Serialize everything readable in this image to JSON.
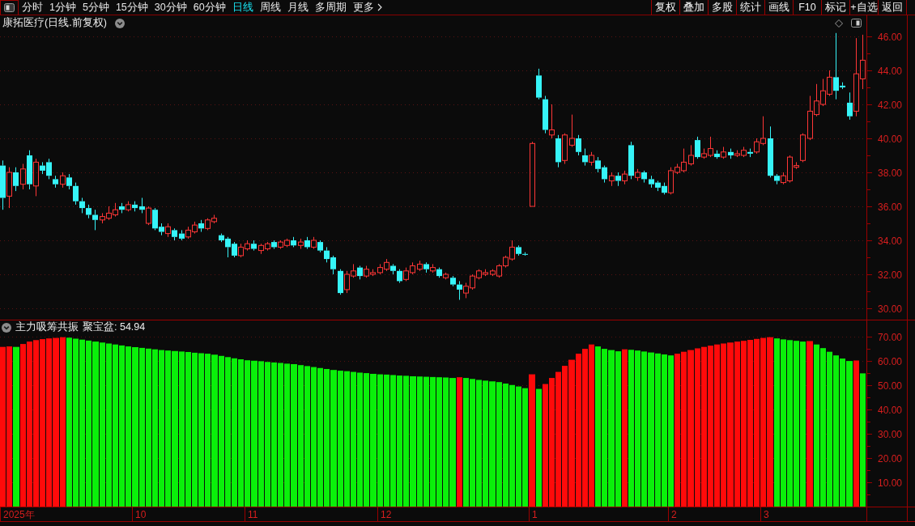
{
  "toolbar": {
    "tabs": [
      {
        "label": "分时",
        "kind": "tab",
        "selected": false
      },
      {
        "label": "1分钟",
        "kind": "tab",
        "selected": false
      },
      {
        "label": "5分钟",
        "kind": "tab",
        "selected": false
      },
      {
        "label": "15分钟",
        "kind": "tab",
        "selected": false
      },
      {
        "label": "30分钟",
        "kind": "tab",
        "selected": false
      },
      {
        "label": "60分钟",
        "kind": "tab",
        "selected": false
      },
      {
        "label": "日线",
        "kind": "tab",
        "selected": true
      },
      {
        "label": "周线",
        "kind": "tab",
        "selected": false
      },
      {
        "label": "月线",
        "kind": "tab",
        "selected": false
      },
      {
        "label": "多周期",
        "kind": "tab",
        "selected": false
      },
      {
        "label": "更多",
        "kind": "menu",
        "selected": false
      }
    ],
    "buttons": [
      "复权",
      "叠加",
      "多股",
      "统计",
      "画线",
      "F10",
      "标记",
      "+自选",
      "返回"
    ]
  },
  "price_panel": {
    "title": "康拓医疗(日线.前复权)",
    "y_axis_labels": [
      "46.00",
      "44.00",
      "42.00",
      "40.00",
      "38.00",
      "36.00",
      "34.00",
      "32.00",
      "30.00"
    ]
  },
  "indicator_panel": {
    "name": "主力吸筹共振",
    "reading": "聚宝盆: 54.94",
    "chart_data": {
      "type": "bar",
      "grid": true,
      "ylim": [
        0,
        76.7
      ],
      "yticks": [
        {
          "value": 70,
          "label": "70.00"
        },
        {
          "value": 60,
          "label": "60.00"
        },
        {
          "value": 50,
          "label": "50.00"
        },
        {
          "value": 40,
          "label": "40.00"
        },
        {
          "value": 30,
          "label": "30.00"
        },
        {
          "value": 20,
          "label": "20.00"
        },
        {
          "value": 10,
          "label": "10.00"
        }
      ],
      "values": [
        65.8,
        66.0,
        65.8,
        67.0,
        68.0,
        68.6,
        69.0,
        69.3,
        69.5,
        69.8,
        69.6,
        69.2,
        68.8,
        68.4,
        68.0,
        67.6,
        67.2,
        66.8,
        66.4,
        66.0,
        65.7,
        65.4,
        65.1,
        64.8,
        64.5,
        64.3,
        64.1,
        63.9,
        63.7,
        63.4,
        63.2,
        63.0,
        62.6,
        62.1,
        61.6,
        61.1,
        60.7,
        60.3,
        60.1,
        59.9,
        59.6,
        59.4,
        59.2,
        58.9,
        58.7,
        58.3,
        57.9,
        57.5,
        57.1,
        56.7,
        56.3,
        56.0,
        55.8,
        55.5,
        55.2,
        55.0,
        54.7,
        54.5,
        54.4,
        54.2,
        54.0,
        53.9,
        53.7,
        53.6,
        53.5,
        53.4,
        53.3,
        53.2,
        53.0,
        53.3,
        53.0,
        52.6,
        52.2,
        51.9,
        51.6,
        51.3,
        50.7,
        50.1,
        49.5,
        48.8,
        54.5,
        48.5,
        50.5,
        53.0,
        55.5,
        58.0,
        60.5,
        63.0,
        65.0,
        66.8,
        66.0,
        65.0,
        64.5,
        64.0,
        64.8,
        64.6,
        64.3,
        63.9,
        63.5,
        63.1,
        62.7,
        62.3,
        63.0,
        63.8,
        64.5,
        65.2,
        65.8,
        66.3,
        66.8,
        67.2,
        67.6,
        68.0,
        68.3,
        68.7,
        69.1,
        69.5,
        69.8,
        69.3,
        68.9,
        68.6,
        68.3,
        68.0,
        68.2,
        66.8,
        65.3,
        63.8,
        62.3,
        61.0,
        60.0,
        60.2,
        54.9
      ]
    }
  },
  "time_axis": {
    "labels": [
      "2025年",
      "10",
      "11",
      "12",
      "1",
      "2",
      "3"
    ]
  }
}
